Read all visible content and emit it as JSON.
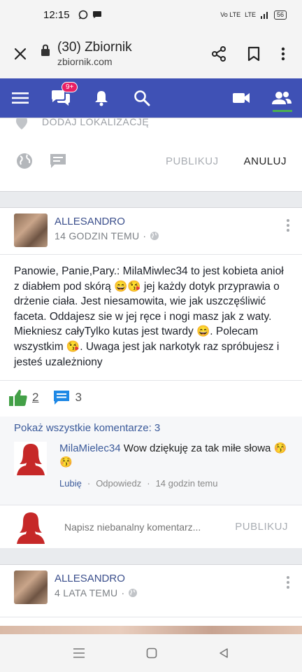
{
  "status": {
    "time": "12:15",
    "network": "Vo LTE",
    "signal": "LTE",
    "battery": "56"
  },
  "browser": {
    "title": "(30) Zbiornik",
    "domain": "zbiornik.com"
  },
  "nav": {
    "badge": "9+"
  },
  "composer": {
    "location": "DODAJ LOKALIZACJĘ",
    "publish": "PUBLIKUJ",
    "cancel": "ANULUJ"
  },
  "post": {
    "author": "ALLESANDRO",
    "time": "14 GODZIN TEMU",
    "separator": "·",
    "body": "Panowie, Panie,Pary.: MilaMiwlec34 to jest kobieta anioł z diabłem pod skórą 😄😘 jej każdy dotyk przyprawia o drżenie ciała. Jest niesamowita, wie jak uszczęśliwić faceta. Oddajesz sie w jej ręce i nogi masz jak z waty. Miekniesz całyTylko kutas jest twardy 😄. Polecam wszystkim 😘. Uwaga jest jak narkotyk raz spróbujesz i jesteś uzależniony",
    "likes": "2",
    "comments": "3",
    "show_all": "Pokaż wszystkie komentarze: 3",
    "comment": {
      "author": "MilaMielec34",
      "text": "Wow dziękuję za tak miłe słowa 😚😚",
      "like": "Lubię",
      "reply": "Odpowiedz",
      "time": "14 godzin temu",
      "separator": "·"
    },
    "input_placeholder": "Napisz niebanalny komentarz...",
    "publish": "PUBLIKUJ"
  },
  "post2": {
    "author": "ALLESANDRO",
    "time": "4 LATA TEMU",
    "separator": "·"
  }
}
